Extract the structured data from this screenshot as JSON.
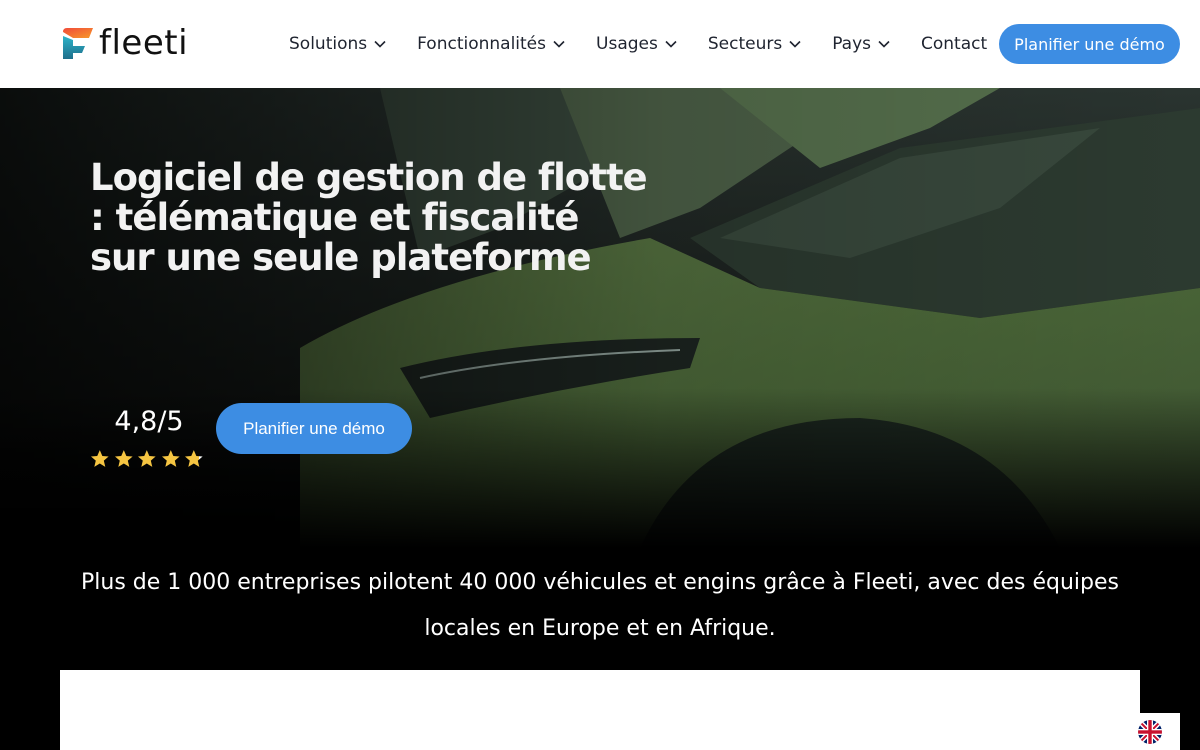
{
  "header": {
    "logo_text": "fleeti",
    "nav": [
      {
        "label": "Solutions",
        "icon": "chevron-down-icon"
      },
      {
        "label": "Fonctionnalités",
        "icon": "chevron-down-icon"
      },
      {
        "label": "Usages",
        "icon": "chevron-down-icon"
      },
      {
        "label": "Secteurs",
        "icon": "chevron-down-icon"
      },
      {
        "label": "Pays",
        "icon": "chevron-down-icon"
      },
      {
        "label": "Contact"
      }
    ],
    "cta_label": "Planifier une démo"
  },
  "hero": {
    "title": "Logiciel de gestion de flotte : télématique et fiscalité sur une seule plateforme",
    "rating_value": "4,8/5",
    "rating_stars": 4.8,
    "cta_label": "Planifier une démo"
  },
  "stats": {
    "text": "Plus de 1 000 entreprises pilotent 40 000 véhicules et engins grâce à Fleeti, avec des équipes locales en Europe et en Afrique."
  },
  "language": {
    "icon": "uk-flag-icon"
  },
  "colors": {
    "accent": "#3d8de3",
    "header_bg": "#ffffff",
    "page_bg": "#000000",
    "star": "#f5c542"
  }
}
